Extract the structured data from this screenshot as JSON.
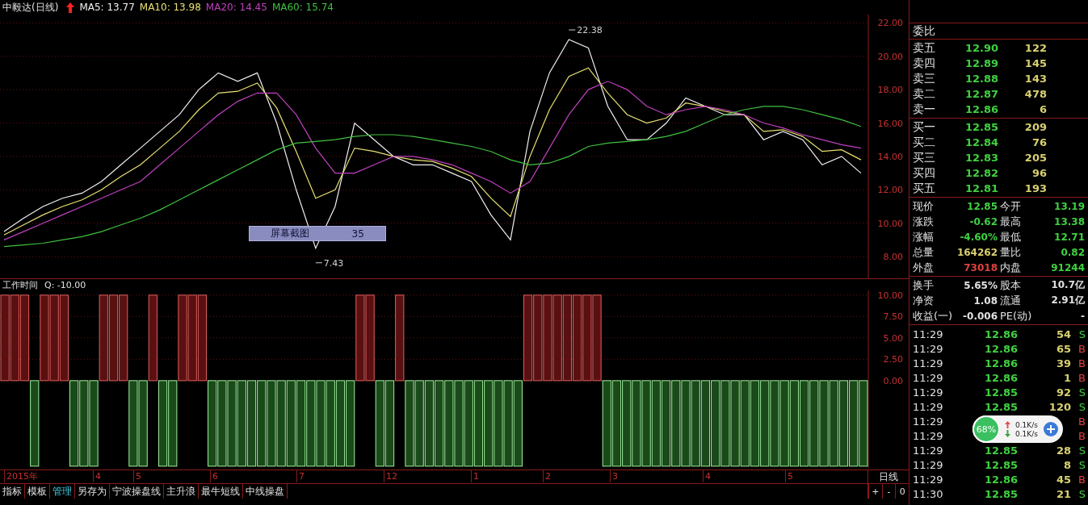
{
  "header": {
    "title": "中毅达(日线)",
    "ma": [
      {
        "text": "MA5: 13.77",
        "color": "#f0f0f0"
      },
      {
        "text": "MA10: 13.98",
        "color": "#e8e070"
      },
      {
        "text": "MA20: 14.45",
        "color": "#c040c0"
      },
      {
        "text": "MA60: 15.74",
        "color": "#40c040"
      }
    ]
  },
  "price_chart": {
    "chart_data": {
      "type": "line",
      "grid": true,
      "ylim": [
        6.7,
        22.5
      ],
      "yticks": [
        {
          "value": 8,
          "label": "8.00"
        },
        {
          "value": 10,
          "label": "10.00"
        },
        {
          "value": 12,
          "label": "12.00"
        },
        {
          "value": 14,
          "label": "14.00"
        },
        {
          "value": 16,
          "label": "16.00"
        },
        {
          "value": 18,
          "label": "18.00"
        },
        {
          "value": 20,
          "label": "20.00"
        },
        {
          "value": 22,
          "label": "22.00"
        }
      ],
      "series": [
        {
          "color": "#f0f0f0",
          "values": [
            9.5,
            10.3,
            11,
            11.5,
            11.8,
            12.5,
            13.5,
            14.5,
            15.5,
            16.5,
            18,
            19,
            18.5,
            19,
            16,
            12,
            8.5,
            11,
            16,
            15,
            14,
            13.5,
            13.5,
            13,
            12.5,
            10.5,
            9,
            15.5,
            19,
            21,
            20.5,
            17,
            15,
            15,
            16,
            17.5,
            17,
            16.5,
            16.5,
            15,
            15.5,
            15,
            13.5,
            14,
            13
          ]
        },
        {
          "color": "#e8e070",
          "values": [
            9.3,
            9.9,
            10.5,
            11,
            11.4,
            12,
            12.8,
            13.5,
            14.5,
            15.5,
            16.8,
            17.8,
            17.9,
            18.4,
            16.9,
            14.3,
            11.5,
            12,
            14.5,
            14.3,
            14,
            13.8,
            13.7,
            13.3,
            12.8,
            11.5,
            10.4,
            14,
            16.8,
            18.8,
            19.3,
            17.8,
            16.5,
            16,
            16.3,
            17.2,
            17,
            16.7,
            16.5,
            15.5,
            15.6,
            15.2,
            14.3,
            14.4,
            13.8
          ]
        },
        {
          "color": "#c040c0",
          "values": [
            9,
            9.5,
            10,
            10.5,
            11,
            11.5,
            12,
            12.5,
            13.5,
            14.5,
            15.5,
            16.5,
            17.3,
            17.8,
            17.8,
            16.5,
            14.5,
            13,
            13,
            13.5,
            14,
            14,
            13.8,
            13.5,
            13,
            12.5,
            11.8,
            12.5,
            14.5,
            16.5,
            18,
            18.5,
            18,
            17,
            16.5,
            16.8,
            17,
            16.8,
            16.5,
            16,
            15.7,
            15.3,
            15,
            14.7,
            14.5
          ]
        },
        {
          "color": "#40c040",
          "values": [
            8.6,
            8.7,
            8.8,
            9,
            9.2,
            9.5,
            9.9,
            10.3,
            10.8,
            11.4,
            12,
            12.6,
            13.2,
            13.8,
            14.4,
            14.8,
            14.9,
            15,
            15.2,
            15.3,
            15.3,
            15.2,
            15,
            14.8,
            14.6,
            14.3,
            13.8,
            13.5,
            13.6,
            14,
            14.6,
            14.8,
            14.9,
            15,
            15.2,
            15.5,
            16,
            16.5,
            16.8,
            17,
            17,
            16.8,
            16.5,
            16.2,
            15.8
          ]
        }
      ]
    },
    "price_labels": [
      {
        "kind": "high",
        "text": "22.38"
      },
      {
        "kind": "low",
        "text": "7.43"
      }
    ],
    "tooltip": {
      "label": "屏幕截图",
      "value": "35"
    }
  },
  "indicator": {
    "title": "工作时间",
    "reading": "Q: -10.00",
    "chart_data": {
      "type": "bar",
      "grid": true,
      "ylim": [
        -10.2,
        10.55
      ],
      "yticks": [
        {
          "value": 0,
          "label": "0.00"
        },
        {
          "value": 2.5,
          "label": "2.50"
        },
        {
          "value": 5,
          "label": "5.00"
        },
        {
          "value": 7.5,
          "label": "7.50"
        },
        {
          "value": 10,
          "label": "10.00"
        }
      ],
      "values": [
        10,
        10,
        10,
        -10,
        10,
        10,
        10,
        -10,
        -10,
        -10,
        10,
        10,
        10,
        -10,
        -10,
        10,
        -10,
        -10,
        10,
        10,
        10,
        -10,
        -10,
        -10,
        -10,
        -10,
        -10,
        -10,
        -10,
        -10,
        -10,
        -10,
        -10,
        -10,
        -10,
        -10,
        10,
        10,
        -10,
        -10,
        10,
        -10,
        -10,
        -10,
        -10,
        -10,
        -10,
        -10,
        -10,
        -10,
        -10,
        -10,
        -10,
        10,
        10,
        10,
        10,
        10,
        10,
        10,
        10,
        -10,
        -10,
        -10,
        -10,
        -10,
        -10,
        -10,
        -10,
        -10,
        -10,
        -10,
        -10,
        -10,
        -10,
        -10,
        -10,
        -10,
        -10,
        -10,
        -10,
        -10,
        -10,
        -10,
        -10,
        -10,
        -10,
        -10
      ]
    }
  },
  "time_axis": [
    "2015年",
    "4",
    "5",
    "6",
    "7",
    "12",
    "1",
    "2",
    "3",
    "4",
    "5"
  ],
  "toolbar": {
    "tabs": [
      {
        "label": "指标",
        "selected": false
      },
      {
        "label": "模板",
        "selected": false
      },
      {
        "label": "管理",
        "selected": true
      },
      {
        "label": "另存为",
        "selected": false
      },
      {
        "label": "宁波操盘线",
        "selected": false
      },
      {
        "label": "主升浪",
        "selected": false
      },
      {
        "label": "最牛短线",
        "selected": false
      },
      {
        "label": "中线操盘",
        "selected": false
      }
    ],
    "period": "日线",
    "buttons": [
      "+",
      "-",
      "0"
    ]
  },
  "quote": {
    "ratio_label": "委比",
    "asks": [
      {
        "label": "卖五",
        "price": "12.90",
        "volume": "122"
      },
      {
        "label": "卖四",
        "price": "12.89",
        "volume": "145"
      },
      {
        "label": "卖三",
        "price": "12.88",
        "volume": "143"
      },
      {
        "label": "卖二",
        "price": "12.87",
        "volume": "478"
      },
      {
        "label": "卖一",
        "price": "12.86",
        "volume": "6"
      }
    ],
    "bids": [
      {
        "label": "买一",
        "price": "12.85",
        "volume": "209"
      },
      {
        "label": "买二",
        "price": "12.84",
        "volume": "76"
      },
      {
        "label": "买三",
        "price": "12.83",
        "volume": "205"
      },
      {
        "label": "买四",
        "price": "12.82",
        "volume": "96"
      },
      {
        "label": "买五",
        "price": "12.81",
        "volume": "193"
      }
    ],
    "stats": [
      {
        "label": "现价",
        "value": "12.85",
        "color": "#40d040"
      },
      {
        "label": "今开",
        "value": "13.19",
        "color": "#40d040"
      },
      {
        "label": "涨跌",
        "value": "-0.62",
        "color": "#40d040"
      },
      {
        "label": "最高",
        "value": "13.38",
        "color": "#40d040"
      },
      {
        "label": "涨幅",
        "value": "-4.60%",
        "color": "#40d040"
      },
      {
        "label": "最低",
        "value": "12.71",
        "color": "#40d040"
      },
      {
        "label": "总量",
        "value": "164262",
        "color": "#d8d070"
      },
      {
        "label": "量比",
        "value": "0.82",
        "color": "#40d040"
      },
      {
        "label": "外盘",
        "value": "73018",
        "color": "#e04040"
      },
      {
        "label": "内盘",
        "value": "91244",
        "color": "#40d040"
      }
    ],
    "finance": [
      {
        "label": "换手",
        "value": "5.65%"
      },
      {
        "label": "股本",
        "value": "10.7亿"
      },
      {
        "label": "净资",
        "value": "1.08"
      },
      {
        "label": "流通",
        "value": "2.91亿"
      },
      {
        "label": "收益(一)",
        "value": "-0.006"
      },
      {
        "label": "PE(动)",
        "value": "-"
      }
    ],
    "ticks": [
      {
        "time": "11:29",
        "price": "12.86",
        "volume": "54",
        "side": "S",
        "buy": false
      },
      {
        "time": "11:29",
        "price": "12.86",
        "volume": "65",
        "side": "B",
        "buy": true
      },
      {
        "time": "11:29",
        "price": "12.86",
        "volume": "39",
        "side": "B",
        "buy": true
      },
      {
        "time": "11:29",
        "price": "12.86",
        "volume": "1",
        "side": "B",
        "buy": true
      },
      {
        "time": "11:29",
        "price": "12.85",
        "volume": "92",
        "side": "S",
        "buy": false
      },
      {
        "time": "11:29",
        "price": "12.85",
        "volume": "120",
        "side": "S",
        "buy": false
      },
      {
        "time": "11:29",
        "side": "B",
        "buy": true
      },
      {
        "time": "11:29",
        "side": "B",
        "buy": true
      },
      {
        "time": "11:29",
        "price": "12.85",
        "volume": "28",
        "side": "S",
        "buy": false
      },
      {
        "time": "11:29",
        "price": "12.85",
        "volume": "8",
        "side": "S",
        "buy": false
      },
      {
        "time": "11:29",
        "price": "12.86",
        "volume": "45",
        "side": "B",
        "buy": true
      },
      {
        "time": "11:30",
        "price": "12.85",
        "volume": "21",
        "side": "S",
        "buy": false
      }
    ]
  },
  "speed_widget": {
    "percent": "68%",
    "upload": "0.1K/s",
    "download": "0.1K/s"
  }
}
